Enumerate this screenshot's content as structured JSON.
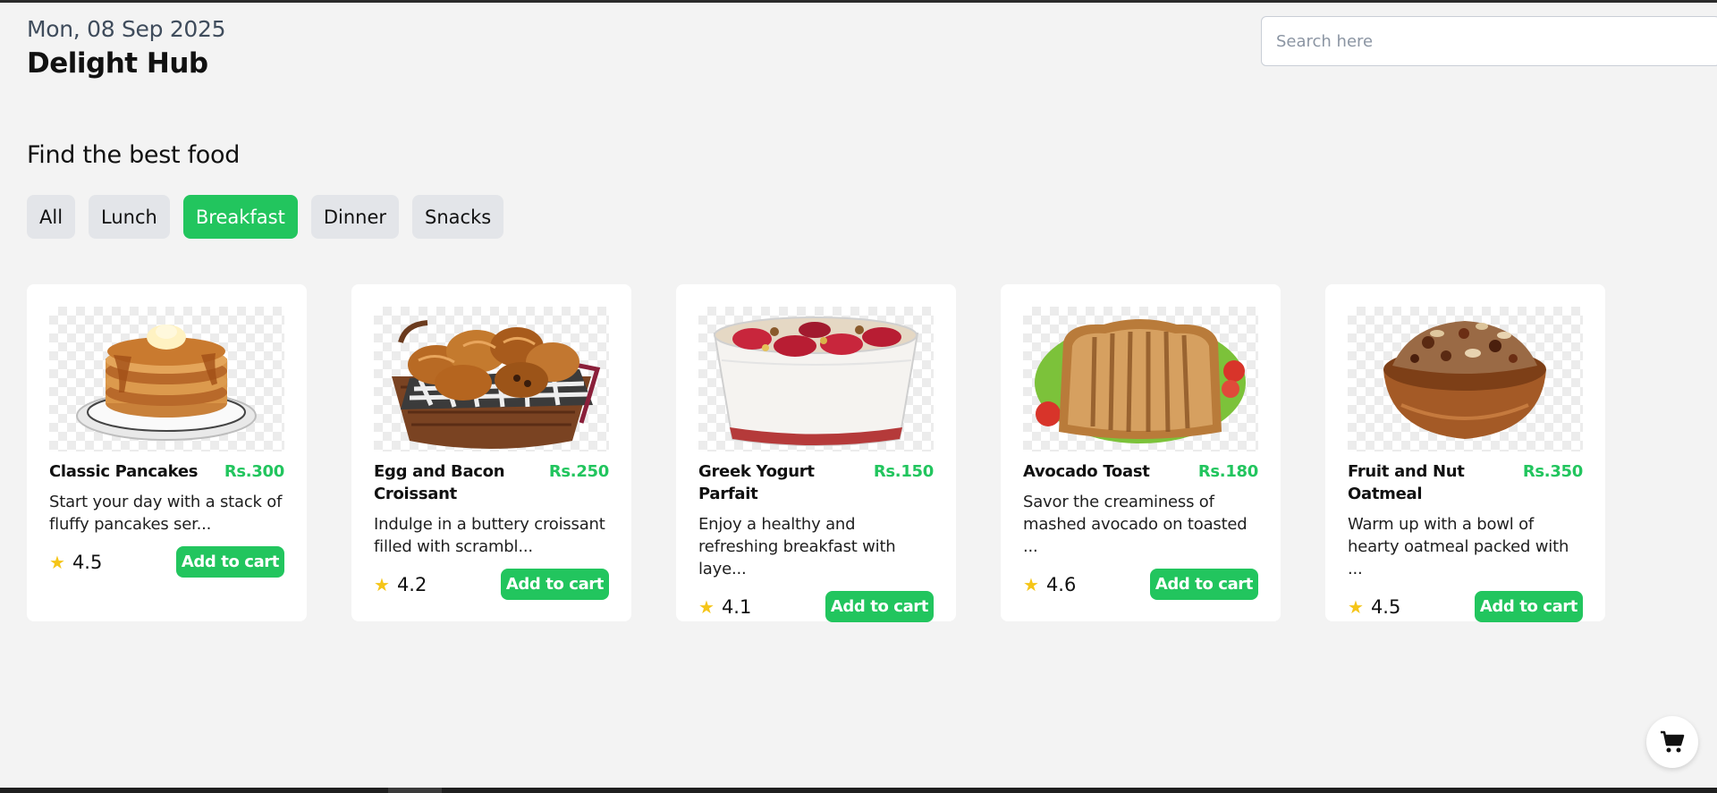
{
  "header": {
    "date": "Mon, 08 Sep 2025",
    "brand": "Delight Hub",
    "search_placeholder": "Search here"
  },
  "section_title": "Find the best food",
  "filters": [
    {
      "label": "All",
      "active": false
    },
    {
      "label": "Lunch",
      "active": false
    },
    {
      "label": "Breakfast",
      "active": true
    },
    {
      "label": "Dinner",
      "active": false
    },
    {
      "label": "Snacks",
      "active": false
    }
  ],
  "cards": [
    {
      "name": "Classic Pancakes",
      "price": "Rs.300",
      "description": "Start your day with a stack of fluffy pancakes ser...",
      "rating": "4.5",
      "button": "Add to cart",
      "image": "pancakes"
    },
    {
      "name": "Egg and Bacon Croissant",
      "price": "Rs.250",
      "description": "Indulge in a buttery croissant filled with scrambl...",
      "rating": "4.2",
      "button": "Add to cart",
      "image": "croissant-basket"
    },
    {
      "name": "Greek Yogurt Parfait",
      "price": "Rs.150",
      "description": "Enjoy a healthy and refreshing breakfast with laye...",
      "rating": "4.1",
      "button": "Add to cart",
      "image": "yogurt-parfait"
    },
    {
      "name": "Avocado Toast",
      "price": "Rs.180",
      "description": "Savor the creaminess of mashed avocado on toasted ...",
      "rating": "4.6",
      "button": "Add to cart",
      "image": "toast-sandwich"
    },
    {
      "name": "Fruit and Nut Oatmeal",
      "price": "Rs.350",
      "description": "Warm up with a bowl of hearty oatmeal packed with ...",
      "rating": "4.5",
      "button": "Add to cart",
      "image": "oatmeal-bowl"
    }
  ],
  "colors": {
    "accent": "#22c55e",
    "background": "#f3f3f3",
    "star": "#f5c518"
  },
  "floating_cart_icon": "shopping-cart-icon"
}
